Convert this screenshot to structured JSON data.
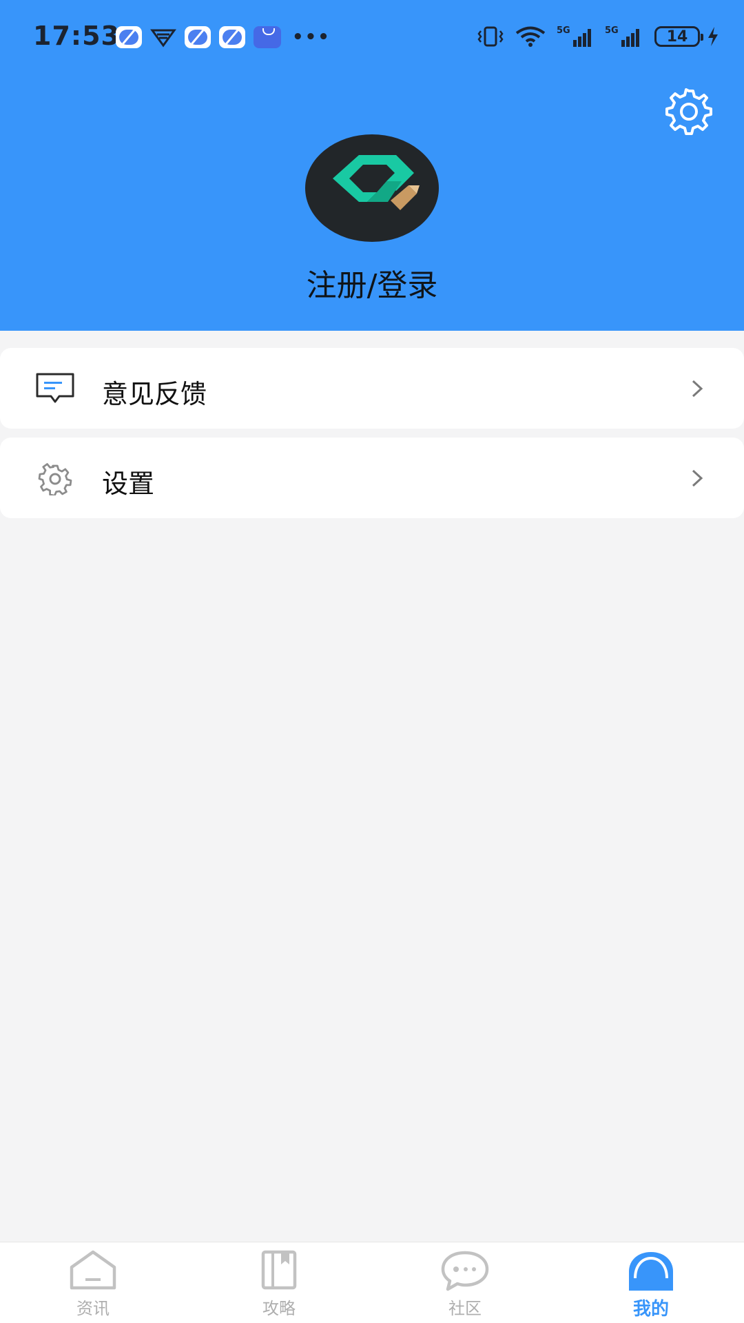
{
  "status_bar": {
    "time": "17:53",
    "battery_level": "14",
    "network_labels": [
      "5G",
      "5G"
    ]
  },
  "header": {
    "settings_icon": "gear-icon",
    "avatar_icon": "app-logo-icon",
    "login_label": "注册/登录",
    "background_color": "#3895fa"
  },
  "menu": {
    "items": [
      {
        "label": "意见反馈",
        "icon": "feedback-icon"
      },
      {
        "label": "设置",
        "icon": "gear-icon"
      }
    ]
  },
  "bottom_nav": {
    "items": [
      {
        "label": "资讯",
        "icon": "home-icon",
        "active": false
      },
      {
        "label": "攻略",
        "icon": "book-icon",
        "active": false
      },
      {
        "label": "社区",
        "icon": "chat-icon",
        "active": false
      },
      {
        "label": "我的",
        "icon": "profile-icon",
        "active": true
      }
    ],
    "active_color": "#3895fa",
    "inactive_color": "#aeaeae"
  }
}
